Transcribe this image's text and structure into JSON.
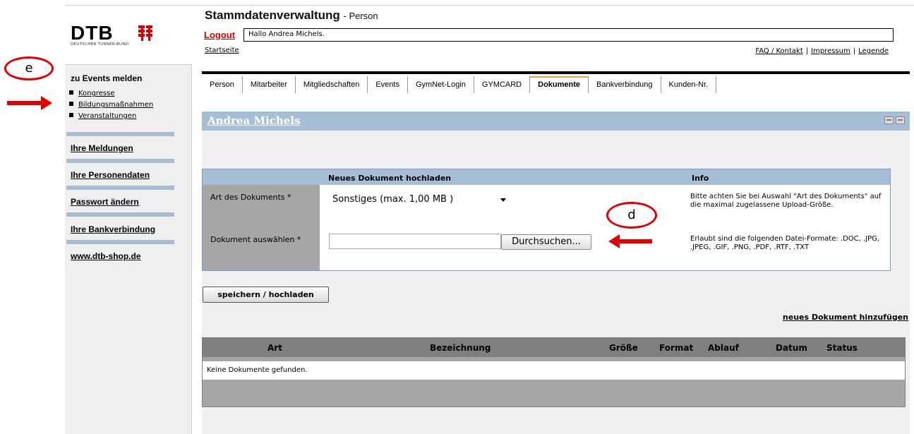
{
  "header": {
    "logo_text": "DTB",
    "logo_subtitle": "DEUTSCHER TURNER-BUND",
    "title": "Stammdatenverwaltung",
    "subtitle": "- Person",
    "logout_label": "Logout",
    "greeting": "Hallo Andrea Michels.",
    "startseite_label": "Startseite",
    "links": {
      "faq": "FAQ / Kontakt",
      "sep1": "|",
      "impressum": "Impressum",
      "sep2": "|",
      "legende": "Legende"
    }
  },
  "sidebar": {
    "events_header": "zu Events melden",
    "event_items": [
      {
        "label": "Kongresse"
      },
      {
        "label": "Bildungsmaßnahmen"
      },
      {
        "label": "Veranstaltungen"
      }
    ],
    "nav": [
      {
        "label": "Ihre Meldungen"
      },
      {
        "label": "Ihre Personendaten"
      },
      {
        "label": "Passwort ändern"
      },
      {
        "label": "Ihre Bankverbindung"
      },
      {
        "label": "www.dtb-shop.de"
      }
    ]
  },
  "tabs": [
    {
      "label": "Person"
    },
    {
      "label": "Mitarbeiter"
    },
    {
      "label": "Mitgliedschaften"
    },
    {
      "label": "Events"
    },
    {
      "label": "GymNet-Login"
    },
    {
      "label": "GYMCARD"
    },
    {
      "label": "Dokumente",
      "active": true
    },
    {
      "label": "Bankverbindung"
    },
    {
      "label": "Kunden-Nr."
    }
  ],
  "person_name": "Andrea Michels",
  "upload": {
    "heading": "Neues Dokument hochladen",
    "info_heading": "Info",
    "type_label": "Art des Dokuments *",
    "type_value": "Sonstiges (max. 1,00 MB )",
    "file_label": "Dokument auswählen *",
    "browse_label": "Durchsuchen...",
    "info_size": "Bitte achten Sie bei Auswahl \"Art des Dokuments\" auf die maximal zugelassene Upload-Größe.",
    "info_formats": "Erlaubt sind die folgenden Datei-Formate: .DOC, .JPG, .JPEG, .GIF, .PNG, .PDF, .RTF, .TXT"
  },
  "save_label": "speichern / hochladen",
  "add_document_label": "neues Dokument hinzufügen",
  "documents_table": {
    "columns": [
      "Art",
      "Bezeichnung",
      "Größe",
      "Format",
      "Ablauf",
      "Datum",
      "Status"
    ],
    "empty_message": "Keine Dokumente gefunden."
  },
  "annotations": {
    "marker_e": "e",
    "marker_d": "d"
  },
  "colors": {
    "accent_blue": "#a6bed6",
    "logout_red": "#cc0000",
    "annotation_red": "#e00000",
    "active_tab_orange": "#e8a440"
  }
}
